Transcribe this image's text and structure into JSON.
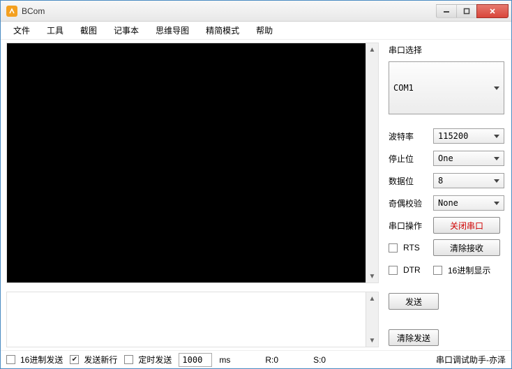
{
  "window": {
    "title": "BCom"
  },
  "menu": {
    "file": "文件",
    "tools": "工具",
    "screenshot": "截图",
    "notepad": "记事本",
    "mindmap": "思维导图",
    "simple_mode": "精简模式",
    "help": "帮助"
  },
  "rx": {
    "value": ""
  },
  "tx": {
    "value": ""
  },
  "serial": {
    "section_label": "串口选择",
    "port_value": "COM1",
    "baud_label": "波特率",
    "baud_value": "115200",
    "stop_label": "停止位",
    "stop_value": "One",
    "data_label": "数据位",
    "data_value": "8",
    "parity_label": "奇偶校验",
    "parity_value": "None",
    "op_label": "串口操作",
    "close_btn": "关闭串口",
    "rts_label": "RTS",
    "clear_rx_btn": "清除接收",
    "dtr_label": "DTR",
    "hex_display_label": "16进制显示"
  },
  "actions": {
    "send_btn": "发送",
    "clear_tx_btn": "清除发送"
  },
  "status": {
    "hex_send_label": "16进制发送",
    "newline_label": "发送新行",
    "timed_send_label": "定时发送",
    "interval_value": "1000",
    "interval_unit": "ms",
    "rx_count": "R:0",
    "tx_count": "S:0",
    "credit": "串口调试助手-亦泽"
  }
}
